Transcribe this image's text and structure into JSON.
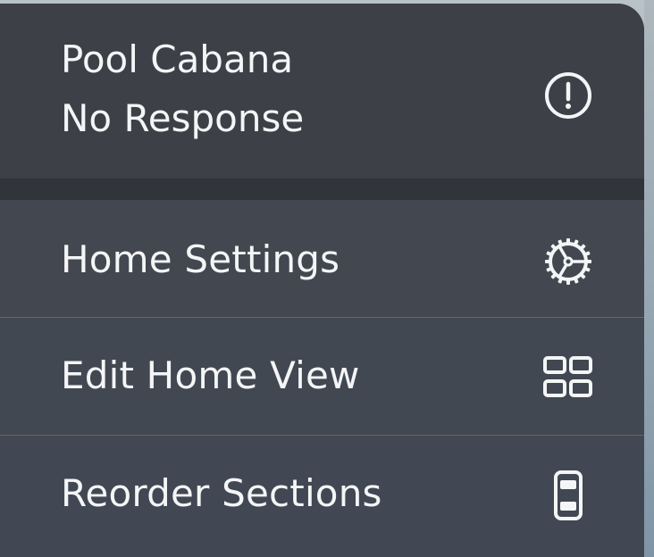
{
  "menu": {
    "status": {
      "title": "Pool Cabana",
      "subtitle": "No Response",
      "icon": "alert-circle-icon"
    },
    "items": [
      {
        "label": "Home Settings",
        "icon": "gear-icon"
      },
      {
        "label": "Edit Home View",
        "icon": "grid-icon"
      },
      {
        "label": "Reorder Sections",
        "icon": "reorder-icon"
      }
    ]
  },
  "colors": {
    "menu_background": "#3f434a",
    "section_gap": "#31353a",
    "text": "#f4f5f6",
    "backdrop": "#a9b5bf"
  }
}
